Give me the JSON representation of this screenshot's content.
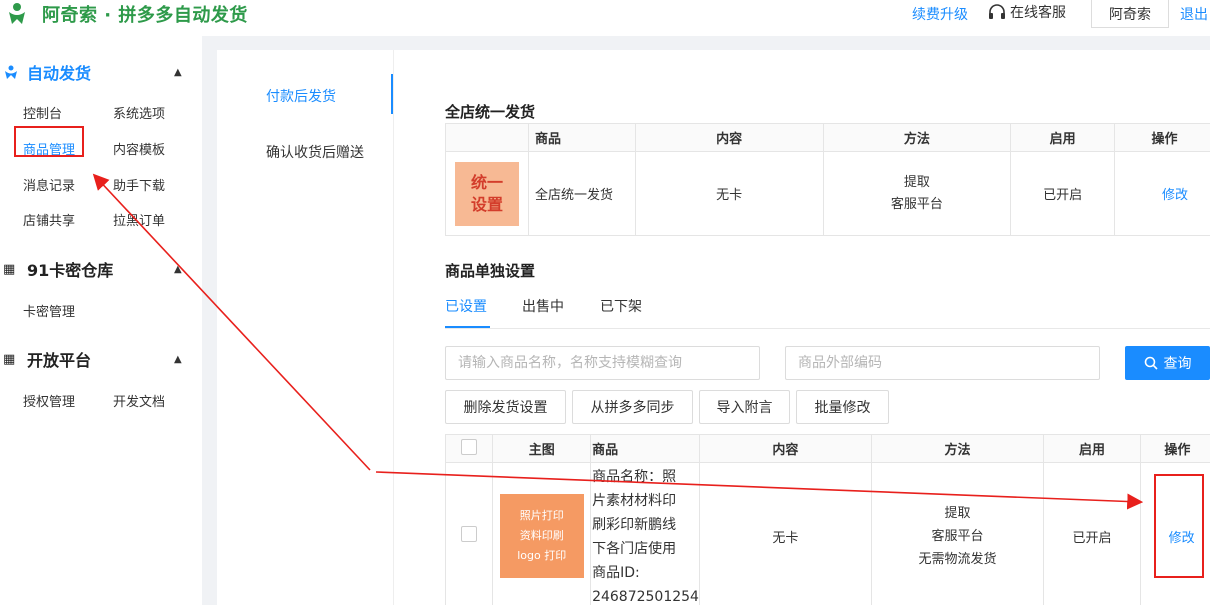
{
  "header": {
    "logo_text": "阿奇索 · 拼多多自动发货",
    "renew_link": "续费升级",
    "service_label": "在线客服",
    "user_name": "阿奇索",
    "logout": "退出"
  },
  "sidebar": {
    "groups": [
      {
        "title": "自动发货",
        "items": [
          "控制台",
          "系统选项",
          "商品管理",
          "内容模板",
          "消息记录",
          "助手下载",
          "店铺共享",
          "拉黑订单"
        ]
      },
      {
        "title": "91卡密仓库",
        "items": [
          "卡密管理"
        ]
      },
      {
        "title": "开放平台",
        "items": [
          "授权管理",
          "开发文档"
        ]
      }
    ]
  },
  "subnav": {
    "items": [
      "付款后发货",
      "确认收货后赠送"
    ]
  },
  "unified": {
    "title": "全店统一发货",
    "headers": [
      "商品",
      "内容",
      "方法",
      "启用",
      "操作"
    ],
    "thumb_line1": "统一",
    "thumb_line2": "设置",
    "row": {
      "name": "全店统一发货",
      "content": "无卡",
      "method_line1": "提取",
      "method_line2": "客服平台",
      "status": "已开启",
      "action": "修改"
    }
  },
  "individual": {
    "title": "商品单独设置",
    "tabs": [
      "已设置",
      "出售中",
      "已下架"
    ],
    "search_placeholder": "请输入商品名称，名称支持模糊查询",
    "code_placeholder": "商品外部编码",
    "search_button": "查询",
    "actions": [
      "删除发货设置",
      "从拼多多同步",
      "导入附言",
      "批量修改"
    ],
    "headers": [
      "主图",
      "商品",
      "内容",
      "方法",
      "启用",
      "操作"
    ],
    "row": {
      "thumb_lines": [
        "照片打印",
        "资料印刷",
        "logo 打印"
      ],
      "product_lines": [
        "商品名称：照",
        "片素材材料印",
        "刷彩印新鹏线",
        "下各门店使用",
        "商品ID:",
        "246872501254"
      ],
      "content": "无卡",
      "method_lines": [
        "提取",
        "客服平台",
        "无需物流发货"
      ],
      "status": "已开启",
      "action": "修改"
    }
  },
  "colors": {
    "accent": "#1a8cff",
    "brand": "#2e9a4a",
    "annotation": "#e8201c"
  }
}
